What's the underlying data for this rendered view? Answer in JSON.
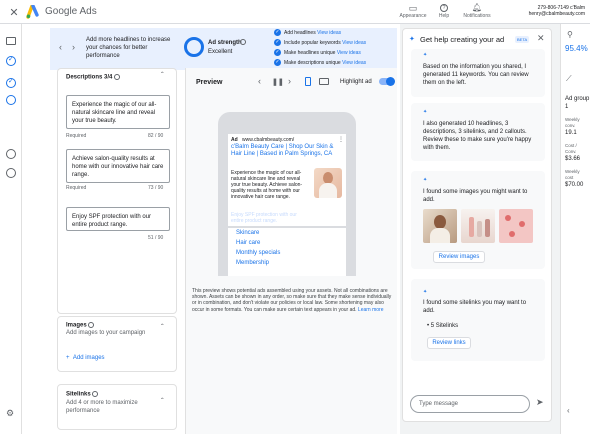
{
  "header": {
    "logo_text": "Google Ads",
    "appearance_label": "Appearance",
    "help_label": "Help",
    "notifications_label": "Notifications",
    "account_id": "279-806-7149 c'Balm",
    "account_email": "henry@cbalmbeauty.com"
  },
  "banner": {
    "message": "Add more headlines to increase your chances for better performance",
    "ad_strength_label": "Ad strength",
    "ad_strength_value": "Excellent",
    "suggestions": [
      {
        "text": "Add headlines",
        "link": "View ideas"
      },
      {
        "text": "Include popular keywords",
        "link": "View ideas"
      },
      {
        "text": "Make headlines unique",
        "link": "View ideas"
      },
      {
        "text": "Make descriptions unique",
        "link": "View ideas"
      }
    ]
  },
  "descriptions": {
    "title": "Descriptions 3/4",
    "items": [
      {
        "text": "Experience the magic of our all-natural skincare line and reveal your true beauty.",
        "meta": "Required",
        "count": "82 / 90"
      },
      {
        "text": "Achieve salon-quality results at home with our innovative hair care range.",
        "meta": "Required",
        "count": "73 / 90"
      },
      {
        "text": "Enjoy SPF protection with our entire product range.",
        "meta": "",
        "count": "51 / 90"
      }
    ]
  },
  "images": {
    "title": "Images",
    "subtitle": "Add images to your campaign",
    "add_label": "Add images"
  },
  "sitelinks": {
    "title": "Sitelinks",
    "subtitle": "Add 4 or more to maximize performance"
  },
  "preview": {
    "title": "Preview",
    "highlight_label": "Highlight ad",
    "ad_badge": "Ad",
    "ad_url": "www.cbalmbeauty.com/",
    "ad_headline": "c'Balm Beauty Care | Shop Our Skin & Hair Line | Based in Palm Springs, CA",
    "ad_description": "Experience the magic of our all-natural skincare line and reveal your true beauty. Achieve salon-quality results at home with our innovative hair care range.",
    "ad_faded": "Enjoy SPF protection with our entire product range.",
    "sitelinks": [
      "Skincare",
      "Hair care",
      "Monthly specials",
      "Membership"
    ],
    "disclaimer": "This preview shows potential ads assembled using your assets. Not all combinations are shown. Assets can be shown in any order, so make sure that they make sense individually or in combination, and don't violate our policies or local law. Some shortening may also occur in some formats. You can make sure certain text appears in your ad.",
    "learn_more": "Learn more"
  },
  "assistant": {
    "title": "Get help creating your ad",
    "beta": "BETA",
    "msg1": "Based on the information you shared, I generated 11 keywords. You can review them on the left.",
    "msg2": "I also generated 10 headlines, 3 descriptions, 3 sitelinks, and 2 callouts. Review these to make sure you're happy with them.",
    "msg3": "I found some images you might want to add.",
    "review_images": "Review images",
    "msg4": "I found some sitelinks you may want to add.",
    "sitelinks_count": "5 Sitelinks",
    "review_links": "Review links",
    "input_placeholder": "Type message"
  },
  "right_panel": {
    "percent": "95.4%",
    "ad_group": "Ad group 1",
    "weekly_label": "Weekly conv.",
    "weekly_value": "19.1",
    "cost_label": "Cost / Conv.",
    "cost_value": "$3.66",
    "wcost_label": "Weekly cost",
    "wcost_value": "$70.00"
  }
}
